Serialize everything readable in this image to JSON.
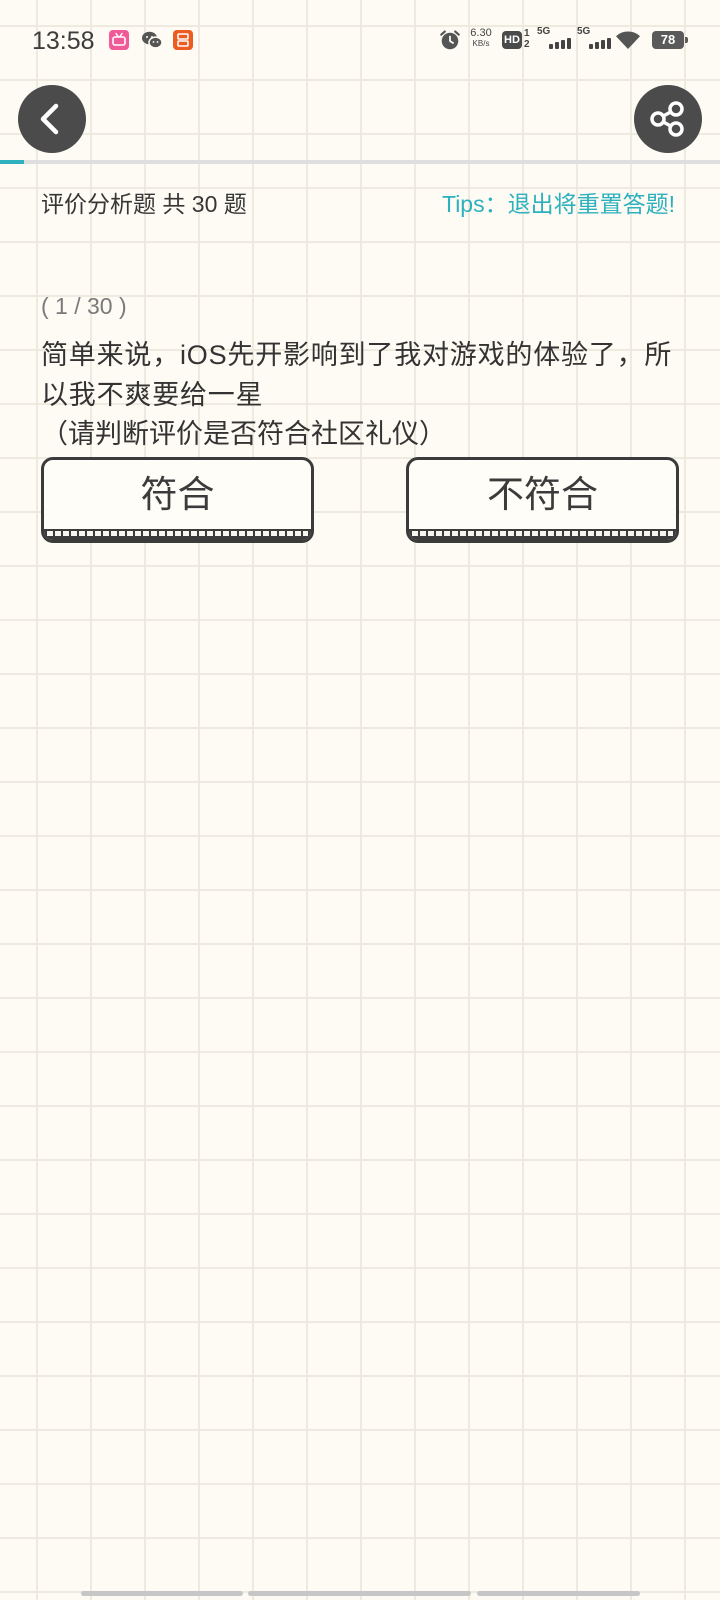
{
  "colors": {
    "background": "#fdfbf3",
    "accent": "#2eb1bf",
    "button_outline": "#3b3b3b",
    "nav_button": "#4b4b4b"
  },
  "status_bar": {
    "time": "13:58",
    "notification_icons": [
      "pink-app-icon",
      "wechat-icon",
      "orange-app-icon"
    ],
    "alarm_icon": "alarm-clock-icon",
    "net_speed": {
      "value": "6.30",
      "unit": "KB/s"
    },
    "hd_badge": {
      "label": "HD",
      "sim_top": "1",
      "sim_bottom": "2"
    },
    "signals": [
      {
        "label": "5G",
        "bars": 4
      },
      {
        "label": "5G",
        "bars": 4
      }
    ],
    "wifi_icon": "wifi-icon",
    "battery": {
      "level": "78"
    }
  },
  "nav": {
    "back_icon": "chevron-left-icon",
    "share_icon": "share-icon"
  },
  "progress": {
    "fraction": 0.033
  },
  "header": {
    "title": "评价分析题 共 30 题",
    "tips": "Tips：退出将重置答题!"
  },
  "question": {
    "counter": "( 1 / 30 )",
    "text": "简单来说，iOS先开影响到了我对游戏的体验了，所以我不爽要给一星",
    "instruction": "（请判断评价是否符合社区礼仪）"
  },
  "answers": [
    {
      "label": "符合"
    },
    {
      "label": "不符合"
    }
  ]
}
